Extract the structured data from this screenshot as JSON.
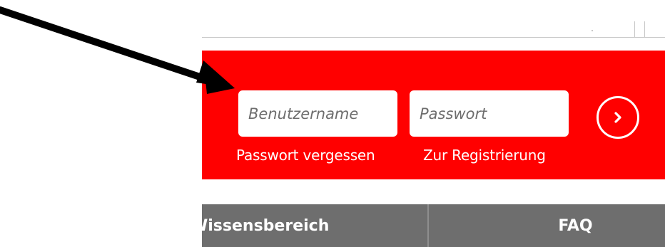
{
  "login": {
    "username_placeholder": "Benutzername",
    "password_placeholder": "Passwort",
    "forgot_password_label": "Passwort vergessen",
    "register_label": "Zur Registrierung",
    "submit_icon": "chevron-right-circle-icon"
  },
  "nav": {
    "items": [
      {
        "label": "Wissensbereich"
      },
      {
        "label": "FAQ"
      }
    ]
  },
  "annotation": {
    "icon": "arrow-icon",
    "color": "#000000"
  },
  "colors": {
    "brand_red": "#ff0000",
    "nav_gray": "#6e6e6e",
    "text_white": "#ffffff"
  }
}
